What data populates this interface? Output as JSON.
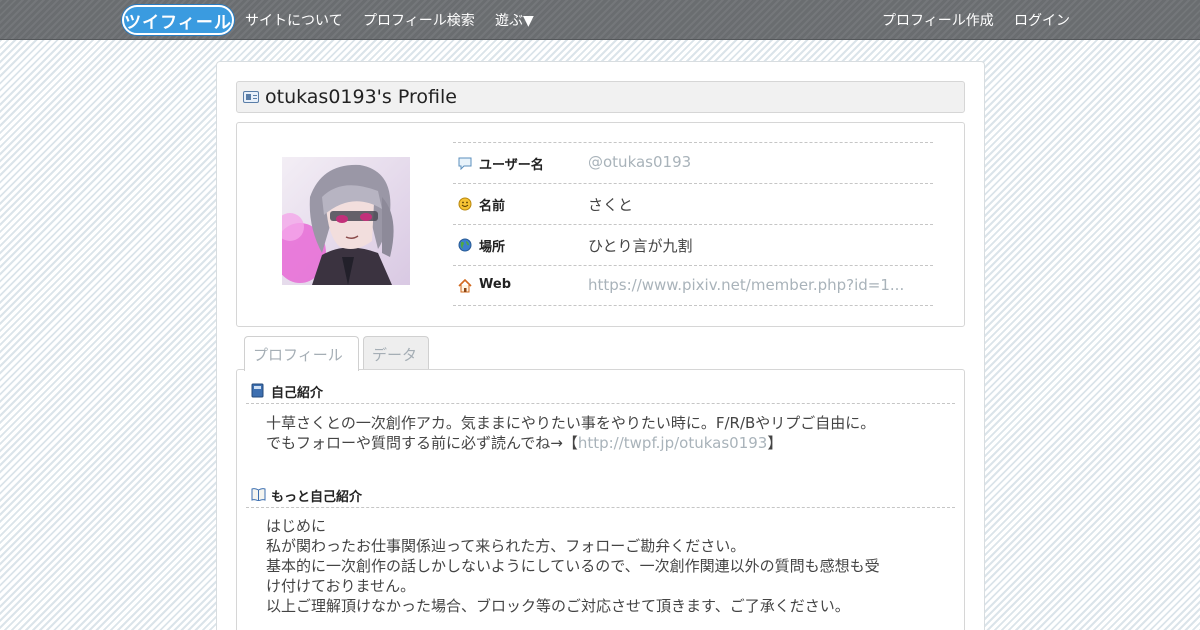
{
  "navbar": {
    "logo": "ツイフィール",
    "left_links": [
      "サイトについて",
      "プロフィール検索",
      "遊ぶ▼"
    ],
    "right_links": [
      "プロフィール作成",
      "ログイン"
    ]
  },
  "profile": {
    "title": "otukas0193's Profile",
    "rows": [
      {
        "icon": "speech-bubble-icon",
        "label": "ユーザー名",
        "value": "@otukas0193"
      },
      {
        "icon": "smiley-icon",
        "label": "名前",
        "value": "さくと"
      },
      {
        "icon": "globe-icon",
        "label": "場所",
        "value": "ひとり言が九割"
      },
      {
        "icon": "home-icon",
        "label": "Web",
        "value": "https://www.pixiv.net/member.php?id=1..."
      }
    ]
  },
  "tabs": [
    "プロフィール",
    "データ"
  ],
  "sections": {
    "intro": {
      "title": "自己紹介",
      "line1": "十草さくとの一次創作アカ。気ままにやりたい事をやりたい時に。F/R/Bやリプご自由に。",
      "line2_prefix": "でもフォローや質問する前に必ず読んでね→【",
      "line2_link": "http://twpf.jp/otukas0193",
      "line2_suffix": "】"
    },
    "more": {
      "title": "もっと自己紹介",
      "lines": [
        "はじめに",
        "私が関わったお仕事関係辿って来られた方、フォローご勘弁ください。",
        "基本的に一次創作の話しかしないようにしているので、一次創作関連以外の質問も感想も受",
        "け付けておりません。",
        "以上ご理解頂けなかった場合、ブロック等のご対応させて頂きます、ご了承ください。"
      ]
    }
  },
  "colors": {
    "navbar": "#6a6d70",
    "link": "#a9b3ba",
    "logo": "#3a9be0"
  }
}
